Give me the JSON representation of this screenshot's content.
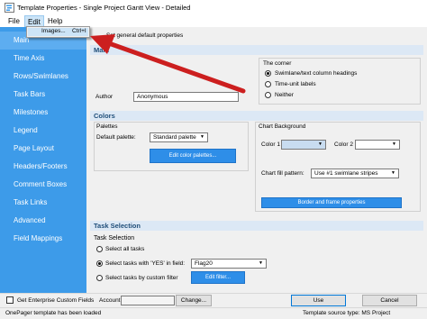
{
  "window": {
    "title": "Template Properties - Single Project Gantt View - Detailed"
  },
  "menu": {
    "file": "File",
    "edit": "Edit",
    "help": "Help"
  },
  "dropdown": {
    "item_label": "Images...",
    "item_shortcut": "Ctrl+I"
  },
  "sidebar": {
    "items": [
      {
        "label": "Main"
      },
      {
        "label": "Time Axis"
      },
      {
        "label": "Rows/Swimlanes"
      },
      {
        "label": "Task Bars"
      },
      {
        "label": "Milestones"
      },
      {
        "label": "Legend"
      },
      {
        "label": "Page Layout"
      },
      {
        "label": "Headers/Footers"
      },
      {
        "label": "Comment Boxes"
      },
      {
        "label": "Task Links"
      },
      {
        "label": "Advanced"
      },
      {
        "label": "Field Mappings"
      }
    ]
  },
  "main": {
    "intro_text": "Set general default properties",
    "section_main": "Main",
    "corner": {
      "title": "The corner",
      "options": [
        {
          "label": "Swimlane/text column headings",
          "selected": true
        },
        {
          "label": "Time-unit labels",
          "selected": false
        },
        {
          "label": "Neither",
          "selected": false
        }
      ]
    },
    "author_label": "Author",
    "author_value": "Anonymous"
  },
  "colors": {
    "section": "Colors",
    "palettes_title": "Palettes",
    "default_palette_label": "Default palette:",
    "default_palette_value": "Standard palette",
    "edit_palettes_button": "Edit color palettes...",
    "chart_background_title": "Chart Background",
    "color1_label": "Color 1",
    "color2_label": "Color 2",
    "color1_swatch": "#c8dcf0",
    "color2_swatch": "#ffffff",
    "chart_fill_label": "Chart fill pattern:",
    "chart_fill_value": "Use #1 swimlane stripes",
    "border_button": "Border and frame properties"
  },
  "task_selection": {
    "section": "Task Selection",
    "title": "Task Selection",
    "options": [
      {
        "label": "Select all tasks",
        "selected": false
      },
      {
        "label": "Select tasks with 'YES' in field:",
        "selected": true
      },
      {
        "label": "Select tasks by custom filter",
        "selected": false
      }
    ],
    "field_value": "Flag20",
    "edit_filter_button": "Edit filter..."
  },
  "bottom": {
    "enterprise_checkbox_label": "Get Enterprise Custom Fields",
    "enterprise_checked": false,
    "account_label": "Account",
    "account_value": "",
    "change_button": "Change...",
    "use_button": "Use",
    "cancel_button": "Cancel"
  },
  "status": {
    "left": "OnePager template has been loaded",
    "right": "Template source type: MS Project"
  },
  "colors_theme": {
    "sidebar_bg": "#3d9be9",
    "accent_blue": "#2e8ee8",
    "arrow_red": "#cc1f1f"
  }
}
